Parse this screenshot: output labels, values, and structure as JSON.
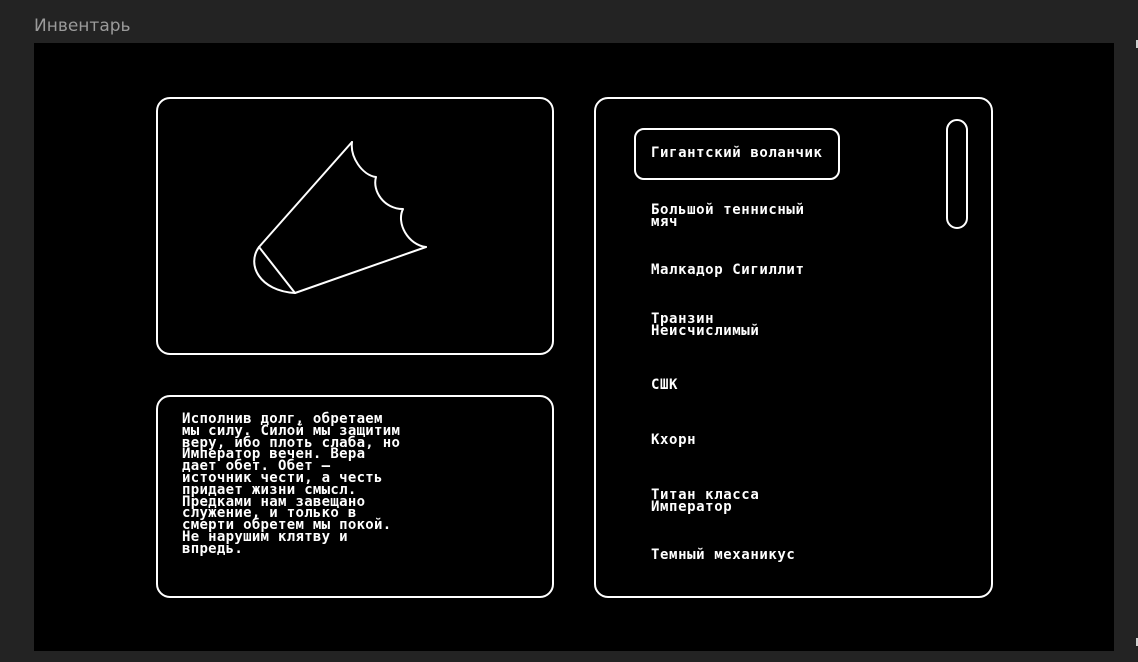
{
  "window": {
    "title": "Инвентарь"
  },
  "description": "Исполнив долг, обретаем\nмы силу. Силой мы защитим\nверу, ибо плоть слаба, но\nИмператор вечен. Вера\nдает обет. Обет –\nисточник чести, а честь\nпридает жизни смысл.\nПредками нам завещано\nслужение, и только в\nсмерти обретем мы покой.\nНе нарушим клятву и\nвпредь.",
  "preview": {
    "icon": "giant-shuttlecock-icon",
    "stroke_color": "#ffffff"
  },
  "inventory": {
    "selected_index": 0,
    "items": [
      {
        "label": "Гигантский воланчик"
      },
      {
        "label": "Большой теннисный\nмяч"
      },
      {
        "label": "Малкадор Сигиллит"
      },
      {
        "label": "Транзин\nНеисчислимый"
      },
      {
        "label": "СШК"
      },
      {
        "label": "Кхорн"
      },
      {
        "label": "Титан класса\nИмператор"
      },
      {
        "label": "Темный механикус"
      }
    ]
  },
  "colors": {
    "background": "#232323",
    "screen": "#000000",
    "foreground": "#ffffff",
    "title": "#9a9a9a"
  }
}
